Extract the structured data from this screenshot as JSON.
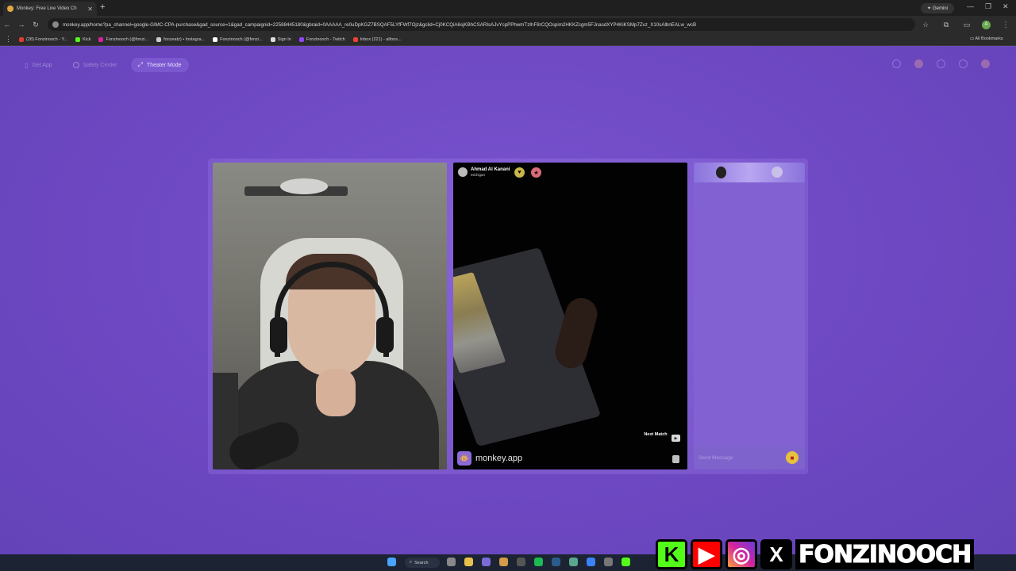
{
  "browser": {
    "tab_title": "Monkey: Free Live Video Ch",
    "new_tab": "+",
    "gemini_label": "Gemini",
    "url": "monkey.app/home?pa_channel=google-GIMC-CPA-purchase&gad_source=1&gad_campaignid=22588445180&gbraid=0AAAAA_re0uDpKGZ7BSQAF5LYfFWf7Ojz&gclid=Cj0KCQiA6sjKBhCSARIsAJvYcpPPhwmTzIhF8rCQOspim2HKKZcgm5FJnasdXYP4KiKSMp7Zvz_X10sAlbnEALw_wcB",
    "bookmarks": [
      {
        "label": "(28) Fonzinooch - Y...",
        "color": "#e03c31"
      },
      {
        "label": "Kick",
        "color": "#53fc18"
      },
      {
        "label": "Fonzinooch (@fonzi...",
        "color": "#d6249f"
      },
      {
        "label": "fonzeatz) • Instagra...",
        "color": "#cccccc"
      },
      {
        "label": "Fonzinooch (@fonzi...",
        "color": "#ffffff"
      },
      {
        "label": "Sign In",
        "color": "#dddddd"
      },
      {
        "label": "Fonzinooch - Twitch",
        "color": "#9146ff"
      },
      {
        "label": "Inbox (221) - alfons...",
        "color": "#ea4335"
      }
    ],
    "all_bookmarks": "All Bookmarks",
    "profile_initial": "A"
  },
  "page": {
    "nav": {
      "get_app": "Get App",
      "safety_center": "Safety Center",
      "theater_mode": "Theater Mode"
    },
    "peer": {
      "name": "Ahmad Al Kanani",
      "location": "Michigan",
      "brand": "monkey.app",
      "next_match": "Next Match"
    },
    "chat": {
      "send_placeholder": "Send Message"
    }
  },
  "taskbar": {
    "search_label": "Search"
  },
  "overlay": {
    "handle": "FONZINOOCH"
  }
}
